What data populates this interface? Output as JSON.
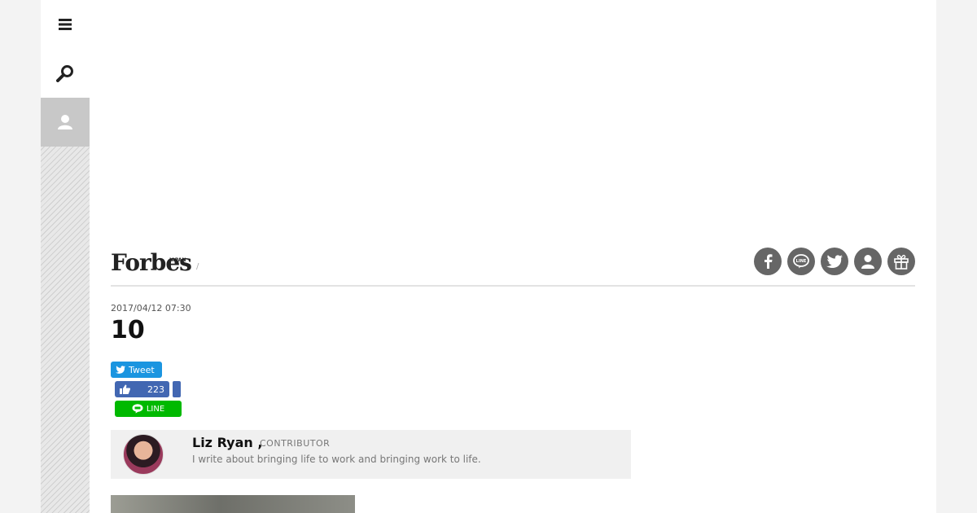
{
  "rail": {
    "menu_icon": "hamburger-menu-icon",
    "search_icon": "search-icon",
    "user_icon": "user-icon"
  },
  "masthead": {
    "logo_text": "Forbes",
    "logo_sub": "JAPAN",
    "crumb_separator": "/",
    "social_icons": [
      "facebook-icon",
      "line-icon",
      "twitter-icon",
      "user-icon",
      "gift-icon"
    ]
  },
  "article": {
    "date": "2017/04/12 07:30",
    "title": "10"
  },
  "share": {
    "tweet_label": "Tweet",
    "like_count": "223",
    "line_label": "LINE"
  },
  "author": {
    "name": "Liz Ryan ,",
    "role": "CONTRIBUTOR",
    "bio": "I write about bringing life to work and bringing work to life."
  },
  "colors": {
    "twitter": "#1b95e0",
    "facebook": "#4267b2",
    "line": "#00b900",
    "social_circle": "#666666",
    "rail_active": "#c8c8c8"
  }
}
